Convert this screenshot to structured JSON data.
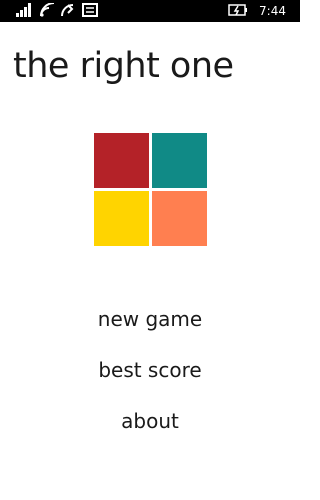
{
  "status_bar": {
    "time": "7:44",
    "icons": [
      "signal-strength-icon",
      "wifi-icon",
      "data-sync-icon",
      "message-icon",
      "battery-charging-icon"
    ]
  },
  "app": {
    "title": "the right one"
  },
  "logo": {
    "tiles": [
      {
        "name": "red",
        "color": "#b42228"
      },
      {
        "name": "teal",
        "color": "#108a86"
      },
      {
        "name": "yellow",
        "color": "#ffd400"
      },
      {
        "name": "orange",
        "color": "#ff7f50"
      }
    ]
  },
  "menu": {
    "new_game": "new game",
    "best_score": "best score",
    "about": "about"
  }
}
